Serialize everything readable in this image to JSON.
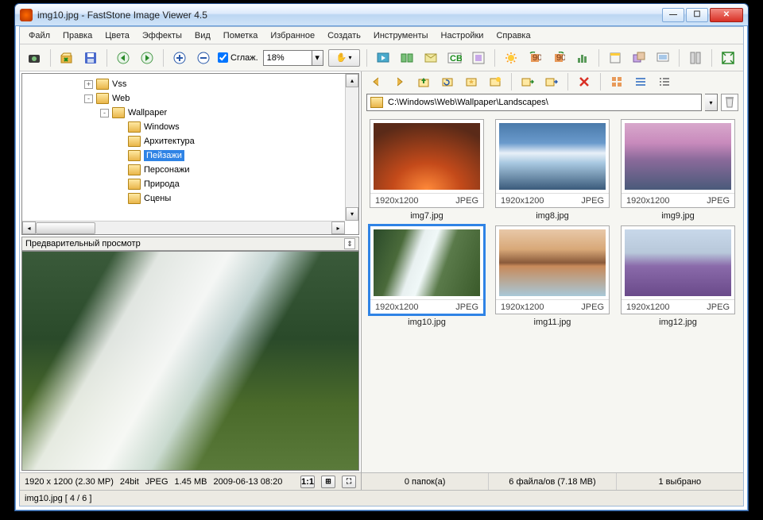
{
  "window_title": "img10.jpg  -  FastStone Image Viewer 4.5",
  "menu": [
    "Файл",
    "Правка",
    "Цвета",
    "Эффекты",
    "Вид",
    "Пометка",
    "Избранное",
    "Создать",
    "Инструменты",
    "Настройки",
    "Справка"
  ],
  "toolbar": {
    "smooth_label": "Сглаж.",
    "zoom_value": "18%"
  },
  "tree": {
    "nodes": [
      {
        "indent": 0,
        "toggle": "+",
        "label": "Vss"
      },
      {
        "indent": 0,
        "toggle": "-",
        "label": "Web"
      },
      {
        "indent": 1,
        "toggle": "-",
        "label": "Wallpaper"
      },
      {
        "indent": 2,
        "toggle": "",
        "label": "Windows"
      },
      {
        "indent": 2,
        "toggle": "",
        "label": "Архитектура"
      },
      {
        "indent": 2,
        "toggle": "",
        "label": "Пейзажи",
        "selected": true
      },
      {
        "indent": 2,
        "toggle": "",
        "label": "Персонажи"
      },
      {
        "indent": 2,
        "toggle": "",
        "label": "Природа"
      },
      {
        "indent": 2,
        "toggle": "",
        "label": "Сцены"
      }
    ]
  },
  "preview_header": "Предварительный просмотр",
  "info": {
    "dims": "1920 x 1200 (2.30 MP)",
    "depth": "24bit",
    "fmt": "JPEG",
    "size": "1.45 MB",
    "date": "2009-06-13 08:20",
    "ratio": "1:1"
  },
  "path": "C:\\Windows\\Web\\Wallpaper\\Landscapes\\",
  "thumbs": [
    {
      "res": "1920x1200",
      "fmt": "JPEG",
      "name": "img7.jpg",
      "cls": "img-canyon"
    },
    {
      "res": "1920x1200",
      "fmt": "JPEG",
      "name": "img8.jpg",
      "cls": "img-glacier"
    },
    {
      "res": "1920x1200",
      "fmt": "JPEG",
      "name": "img9.jpg",
      "cls": "img-pinksky"
    },
    {
      "res": "1920x1200",
      "fmt": "JPEG",
      "name": "img10.jpg",
      "cls": "img-waterfall",
      "selected": true
    },
    {
      "res": "1920x1200",
      "fmt": "JPEG",
      "name": "img11.jpg",
      "cls": "img-arch"
    },
    {
      "res": "1920x1200",
      "fmt": "JPEG",
      "name": "img12.jpg",
      "cls": "img-lavender"
    }
  ],
  "right_status": {
    "folders": "0 папок(а)",
    "files": "6 файла/ов (7.18 MB)",
    "selected": "1 выбрано"
  },
  "statusbar": "img10.jpg [ 4 / 6 ]"
}
